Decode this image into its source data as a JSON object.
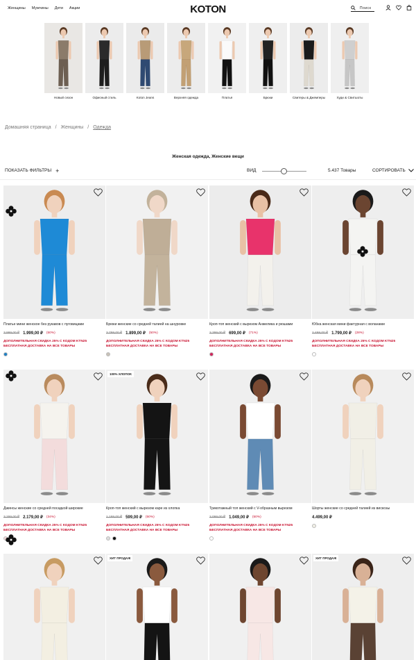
{
  "header": {
    "nav": [
      "Женщины",
      "Мужчины",
      "Дети",
      "Акции"
    ],
    "logo": "KOTON",
    "search_label": "Поиск"
  },
  "categories": [
    {
      "label": "Новый сезон",
      "bg": "#e9e7e4",
      "top": "#8b7b6a",
      "bottom": "#6d5f52"
    },
    {
      "label": "Офисный стиль",
      "bg": "#ececec",
      "top": "#2b2b2b",
      "bottom": "#1e1e1e"
    },
    {
      "label": "Koton Jeans",
      "bg": "#ebebeb",
      "top": "#b89b77",
      "bottom": "#2f4a72"
    },
    {
      "label": "Верхняя одежда",
      "bg": "#ececec",
      "top": "#c7a77b",
      "bottom": "#c2a074"
    },
    {
      "label": "Платья",
      "bg": "#f1f1f1",
      "top": "#fafafa",
      "bottom": "#111111"
    },
    {
      "label": "Брюки",
      "bg": "#efefef",
      "top": "#222222",
      "bottom": "#111111"
    },
    {
      "label": "Свитеры & Джемперы",
      "bg": "#ececec",
      "top": "#1b1b1b",
      "bottom": "#ded9cf"
    },
    {
      "label": "Худи & Свитшоты",
      "bg": "#efefef",
      "top": "#cfcfcf",
      "bottom": "#c6c6c6"
    }
  ],
  "breadcrumb": [
    "Домашняя страница",
    "/",
    "Женщины",
    "/",
    "Одежда"
  ],
  "page_title": "Женская одежда, Женские вещи",
  "toolbar": {
    "filters": "ПОКАЗАТЬ ФИЛЬТРЫ",
    "view": "ВИД",
    "count": "5.437 Товары",
    "sort": "СОРТИРОВАТЬ"
  },
  "products": [
    {
      "name": "Платье мини женское без рукавов с пуговицами",
      "old": "3.999,00 ₽",
      "price": "1.999,00 ₽",
      "disc": "(50%)",
      "promo": "ДОПОЛНИТЕЛЬНАЯ СКИДКА 25% С КОДОМ KTN25",
      "promo2": "БЕСПЛАТНАЯ ДОСТАВКА НА ВСЕ ТОВАРЫ",
      "badge": "",
      "bg": "#ededed",
      "top": "#1e8ad6",
      "bottom": "#1e8ad6",
      "skin": "#f0d2bd",
      "hair": "#c98a52",
      "swatches": [
        "#1e7fc4"
      ]
    },
    {
      "name": "Брюки женские со средней талией на шнуровке",
      "old": "3.799,00 ₽",
      "price": "1.899,00 ₽",
      "disc": "(50%)",
      "promo": "ДОПОЛНИТЕЛЬНАЯ СКИДКА 25% С КОДОМ KTN25",
      "promo2": "БЕСПЛАТНАЯ ДОСТАВКА НА ВСЕ ТОВАРЫ",
      "badge": "",
      "bg": "#f1f1f1",
      "top": "#bfae97",
      "bottom": "#c3b39c",
      "skin": "#f0d8c8",
      "hair": "#c2b29b",
      "swatches": [
        "#c9c2b8"
      ]
    },
    {
      "name": "Кроп-топ женский с вырезом Анжелика и рюшами",
      "old": "2.399,00 ₽",
      "price": "699,00 ₽",
      "disc": "(71%)",
      "promo": "ДОПОЛНИТЕЛЬНАЯ СКИДКА 25% С КОДОМ KTN25",
      "promo2": "БЕСПЛАТНАЯ ДОСТАВКА НА ВСЕ ТОВАРЫ",
      "badge": "",
      "bg": "#ececec",
      "top": "#e8336b",
      "bottom": "#f3f1ec",
      "skin": "#e9c1a5",
      "hair": "#4a2a18",
      "swatches": [
        "#d0265c"
      ]
    },
    {
      "name": "Юбка женская мини фактурная с воланами",
      "old": "2.499,00 ₽",
      "price": "1.799,00 ₽",
      "disc": "(28%)",
      "promo": "ДОПОЛНИТЕЛЬНАЯ СКИДКА 25% С КОДОМ KTN25",
      "promo2": "БЕСПЛАТНАЯ ДОСТАВКА НА ВСЕ ТОВАРЫ",
      "badge": "",
      "bg": "#eeeeee",
      "top": "#f4f4f2",
      "bottom": "#f4f4f2",
      "skin": "#6b4531",
      "hair": "#1a1a1a",
      "swatches": [
        "#ffffff"
      ]
    },
    {
      "name": "Джинсы женские со средней посадкой широкие",
      "old": "3.299,00 ₽",
      "price": "2.179,00 ₽",
      "disc": "(34%)",
      "promo": "ДОПОЛНИТЕЛЬНАЯ СКИДКА 25% С КОДОМ KTN25",
      "promo2": "БЕСПЛАТНАЯ ДОСТАВКА НА ВСЕ ТОВАРЫ",
      "badge": "",
      "bg": "#f0f0f0",
      "top": "#f5f3ee",
      "bottom": "#f3dcdc",
      "skin": "#f0d2bd",
      "hair": "#b98b5e",
      "swatches": [
        "#f2d7d7",
        "#ffffff"
      ]
    },
    {
      "name": "Кроп-топ женский с вырезом каре из хлопка",
      "old": "1.199,00 ₽",
      "price": "599,00 ₽",
      "disc": "(50%)",
      "promo": "ДОПОЛНИТЕЛЬНАЯ СКИДКА 25% С КОДОМ KTN25",
      "promo2": "БЕСПЛАТНАЯ ДОСТАВКА НА ВСЕ ТОВАРЫ",
      "badge": "100% ХЛОПОК",
      "bg": "#f0f0f0",
      "top": "#141414",
      "bottom": "#141414",
      "skin": "#f0d2bd",
      "hair": "#4a2c1a",
      "swatches": [
        "#dddddd",
        "#111111"
      ]
    },
    {
      "name": "Трикотажный топ женский с V-образным вырезом",
      "old": "2.099,00 ₽",
      "price": "1.049,00 ₽",
      "disc": "(50%)",
      "promo": "ДОПОЛНИТЕЛЬНАЯ СКИДКА 25% С КОДОМ KTN25",
      "promo2": "БЕСПЛАТНАЯ ДОСТАВКА НА ВСЕ ТОВАРЫ",
      "badge": "",
      "bg": "#efefef",
      "top": "#ffffff",
      "bottom": "#5f8bb5",
      "skin": "#7a4a33",
      "hair": "#1a1a1a",
      "swatches": [
        "#ffffff"
      ]
    },
    {
      "name": "Шорты женские со средней талией из вискозы",
      "old": "",
      "price": "4.499,00 ₽",
      "disc": "",
      "promo": "",
      "promo2": "",
      "badge": "",
      "bg": "#f0f0f0",
      "top": "#f1efe6",
      "bottom": "#f1efe6",
      "skin": "#f0d2bd",
      "hair": "#b88a5c",
      "swatches": [
        "#f1efe6"
      ]
    },
    {
      "name": "",
      "old": "",
      "price": "",
      "disc": "",
      "promo": "",
      "promo2": "",
      "badge": "",
      "bg": "#f0f0f0",
      "top": "#f3efe2",
      "bottom": "#f3efe2",
      "skin": "#f0d2bd",
      "hair": "#c79b62",
      "swatches": []
    },
    {
      "name": "",
      "old": "",
      "price": "",
      "disc": "",
      "promo": "",
      "promo2": "",
      "badge": "ХИТ ПРОДАЖ",
      "bg": "#f1f1f1",
      "top": "#ffffff",
      "bottom": "#141414",
      "skin": "#8a5a3e",
      "hair": "#1a1a1a",
      "swatches": []
    },
    {
      "name": "",
      "old": "",
      "price": "",
      "disc": "",
      "promo": "",
      "promo2": "",
      "badge": "",
      "bg": "#f0f0f0",
      "top": "#f7e7e5",
      "bottom": "#f7e7e5",
      "skin": "#6e4630",
      "hair": "#1a1a1a",
      "swatches": []
    },
    {
      "name": "",
      "old": "",
      "price": "",
      "disc": "",
      "promo": "",
      "promo2": "",
      "badge": "ХИТ ПРОДАЖ",
      "bg": "#eeeeee",
      "top": "#f4f2e8",
      "bottom": "#5a4234",
      "skin": "#d9b196",
      "hair": "#3a2418",
      "swatches": []
    }
  ],
  "accent_red": "#c8102e"
}
